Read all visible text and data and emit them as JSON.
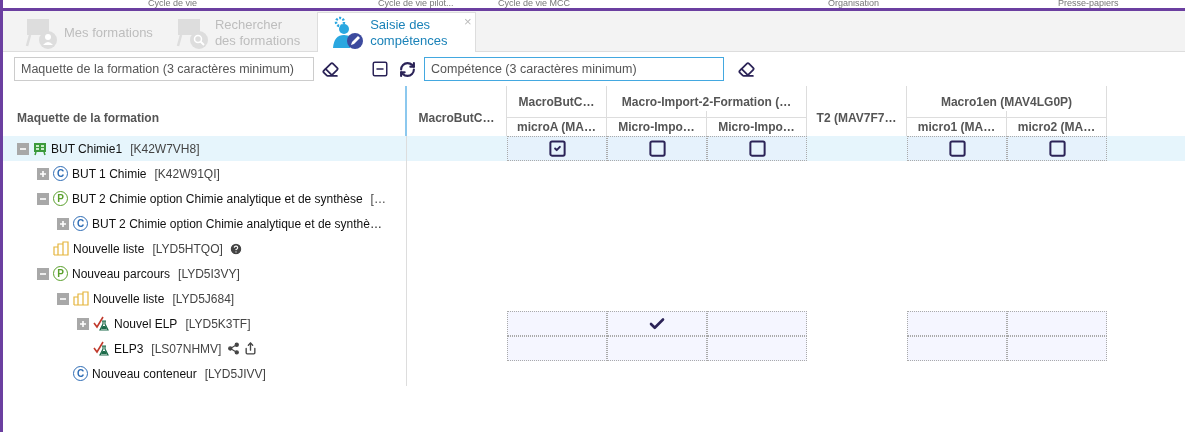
{
  "ribbon_labels": [
    "Cycle de vie",
    "Cycle de vie pilot...",
    "Cycle de vie MCC",
    "Organisation",
    "Presse-papiers"
  ],
  "tabs": [
    {
      "label": "Mes formations",
      "kind": "formations",
      "selected": false
    },
    {
      "label": "Rechercher\ndes formations",
      "kind": "search",
      "selected": false
    },
    {
      "label": "Saisie des\ncompétences",
      "kind": "skills",
      "selected": true,
      "close": "×"
    }
  ],
  "toolbar": {
    "formation_search": {
      "placeholder": "Maquette de la formation (3 caractères minimum)",
      "focused": false
    },
    "skill_search": {
      "placeholder": "Compétence (3 caractères minimum)",
      "focused": true
    }
  },
  "header": {
    "tree_column": "Maquette de la formation",
    "columns": [
      {
        "label": "MacroButC…"
      },
      {
        "label": "MacroButC…",
        "children": [
          {
            "label": "microA (MA…"
          }
        ]
      },
      {
        "label": "Macro-Import-2-Formation (…",
        "children": [
          {
            "label": "Micro-Impo…"
          },
          {
            "label": "Micro-Impo…"
          }
        ]
      },
      {
        "label": "T2 (MAV7F7…"
      },
      {
        "label": "Macro1en (MAV4LG0P)",
        "children": [
          {
            "label": "micro1 (MA…"
          },
          {
            "label": "micro2 (MA…"
          }
        ]
      }
    ]
  },
  "tree": [
    {
      "kind": "formation",
      "label": "BUT Chimie1",
      "code": "[K42W7VH8]",
      "expanded": true,
      "selected": true,
      "cells": [
        {
          "kind": "blank"
        },
        {
          "kind": "checkbox",
          "checked": true
        },
        {
          "kind": "checkbox",
          "checked": false
        },
        {
          "kind": "checkbox",
          "checked": false
        },
        {
          "kind": "blank"
        },
        {
          "kind": "checkbox",
          "checked": false
        },
        {
          "kind": "checkbox",
          "checked": false
        }
      ],
      "children": [
        {
          "kind": "container",
          "badge": "C",
          "label": "BUT 1 Chimie",
          "code": "[K42W91QI]",
          "expanded": false,
          "selected": false
        },
        {
          "kind": "path",
          "badge": "P",
          "label": "BUT 2 Chimie option Chimie analytique et de synthèse",
          "code": "[…",
          "expanded": true,
          "selected": false,
          "children": [
            {
              "kind": "container",
              "badge": "C",
              "label": "BUT 2 Chimie option Chimie analytique et de synthè…",
              "expanded": false,
              "selected": false
            }
          ]
        },
        {
          "kind": "list",
          "label": "Nouvelle liste",
          "code": "[LYD5HTQO]",
          "selected": false,
          "info": true
        },
        {
          "kind": "path",
          "badge": "P",
          "label": "Nouveau parcours",
          "code": "[LYD5I3VY]",
          "expanded": true,
          "selected": false,
          "children": [
            {
              "kind": "list",
              "label": "Nouvelle liste",
              "code": "[LYD5J684]",
              "expanded": true,
              "selected": false,
              "children": [
                {
                  "kind": "elp",
                  "label": "Nouvel ELP",
                  "code": "[LYD5K3TF]",
                  "expanded": false,
                  "selected": false,
                  "cells": [
                    {
                      "kind": "blank"
                    },
                    {
                      "kind": "mark",
                      "checked": false
                    },
                    {
                      "kind": "mark",
                      "checked": true
                    },
                    {
                      "kind": "mark",
                      "checked": false
                    },
                    {
                      "kind": "blank"
                    },
                    {
                      "kind": "mark",
                      "checked": false
                    },
                    {
                      "kind": "mark",
                      "checked": false
                    }
                  ]
                },
                {
                  "kind": "elp",
                  "label": "ELP3",
                  "code": "[LS07NHMV]",
                  "selected": false,
                  "shared": true,
                  "cells": [
                    {
                      "kind": "blank"
                    },
                    {
                      "kind": "mark",
                      "checked": false
                    },
                    {
                      "kind": "mark",
                      "checked": false
                    },
                    {
                      "kind": "mark",
                      "checked": false
                    },
                    {
                      "kind": "blank"
                    },
                    {
                      "kind": "mark",
                      "checked": false
                    },
                    {
                      "kind": "mark",
                      "checked": false
                    }
                  ]
                }
              ]
            },
            {
              "kind": "container",
              "badge": "C",
              "label": "Nouveau conteneur",
              "code": "[LYD5JIVV]",
              "selected": false
            }
          ]
        }
      ]
    }
  ]
}
